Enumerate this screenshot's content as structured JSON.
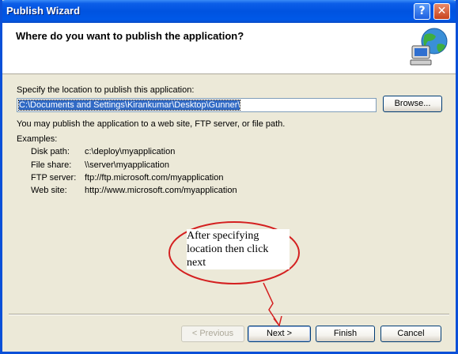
{
  "window": {
    "title": "Publish Wizard",
    "help_label": "?",
    "close_label": "✕"
  },
  "header": {
    "heading": "Where do you want to publish the application?",
    "icon": "globe-computer-icon"
  },
  "form": {
    "location_label": "Specify the location to publish this application:",
    "location_value": "C:\\Documents and Settings\\Kirankumar\\Desktop\\Gunner\\",
    "browse_label": "Browse...",
    "info_text": "You may publish the application to a web site, FTP server, or file path.",
    "examples_label": "Examples:",
    "examples": [
      {
        "key": "Disk path:",
        "value": "c:\\deploy\\myapplication"
      },
      {
        "key": "File share:",
        "value": "\\\\server\\myapplication"
      },
      {
        "key": "FTP server:",
        "value": "ftp://ftp.microsoft.com/myapplication"
      },
      {
        "key": "Web site:",
        "value": "http://www.microsoft.com/myapplication"
      }
    ]
  },
  "annotation": {
    "text": "After specifying location then click next",
    "color": "#d42020"
  },
  "buttons": {
    "previous": "< Previous",
    "next": "Next >",
    "finish": "Finish",
    "cancel": "Cancel"
  }
}
